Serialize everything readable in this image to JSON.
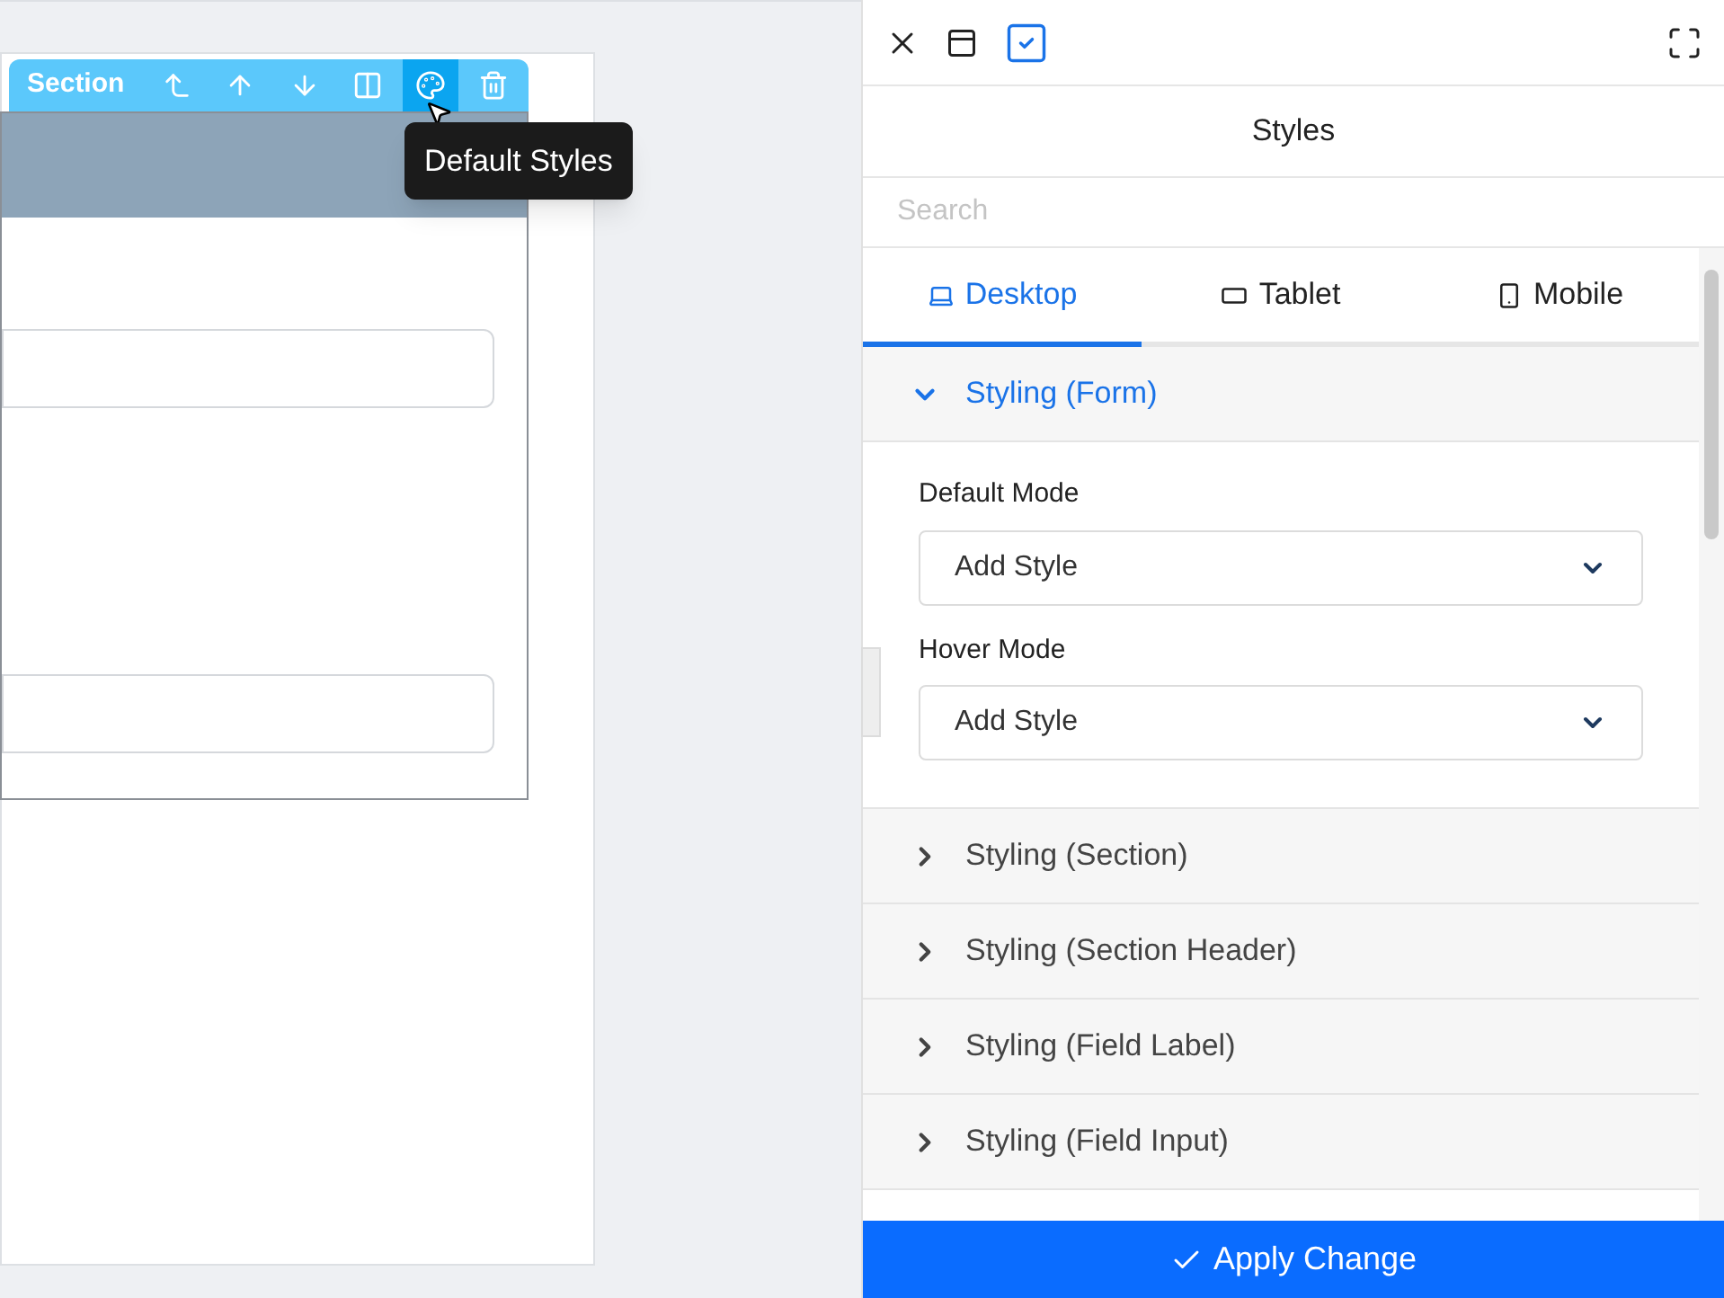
{
  "canvas": {
    "toolbar": {
      "label": "Section",
      "tools": [
        {
          "kind": "move-top",
          "selected": false
        },
        {
          "kind": "up",
          "selected": false
        },
        {
          "kind": "down",
          "selected": false
        },
        {
          "kind": "columns",
          "selected": false
        },
        {
          "kind": "palette",
          "selected": true
        },
        {
          "kind": "delete",
          "selected": false
        }
      ]
    },
    "tooltip": "Default Styles"
  },
  "panel": {
    "title": "Styles",
    "search": {
      "placeholder": "Search"
    },
    "tabs": [
      {
        "label": "Desktop",
        "kind": "desktop",
        "selected": true
      },
      {
        "label": "Tablet",
        "kind": "tablet",
        "selected": false
      },
      {
        "label": "Mobile",
        "kind": "mobile",
        "selected": false
      }
    ],
    "sections": [
      {
        "label": "Styling (Form)",
        "expanded": true,
        "fields": [
          {
            "label": "Default Mode",
            "value": "Add Style"
          },
          {
            "label": "Hover Mode",
            "value": "Add Style"
          }
        ]
      },
      {
        "label": "Styling (Section)",
        "expanded": false
      },
      {
        "label": "Styling (Section Header)",
        "expanded": false
      },
      {
        "label": "Styling (Field Label)",
        "expanded": false
      },
      {
        "label": "Styling (Field Input)",
        "expanded": false
      }
    ],
    "apply_button": "Apply Change"
  }
}
